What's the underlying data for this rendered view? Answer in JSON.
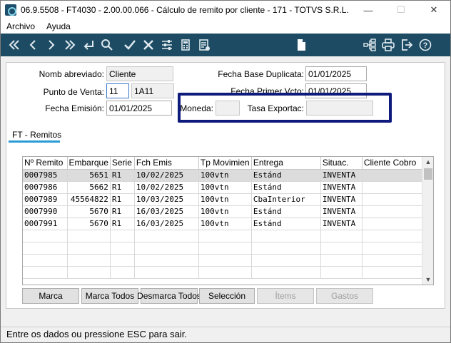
{
  "window": {
    "title": "06.9.5508 - FT4030 - 2.00.00.066 - Cálculo de remito por cliente - 171 - TOTVS S.R.L.",
    "minimize": "—",
    "maximize": "☐",
    "close": "✕"
  },
  "menu": {
    "items": [
      "Archivo",
      "Ayuda"
    ]
  },
  "toolbar": {
    "icons": [
      "first-icon",
      "prev-icon",
      "next-icon",
      "last-icon",
      "return-icon",
      "search-icon",
      "confirm-icon",
      "cancel-icon",
      "settings-sliders-icon",
      "calculator-icon",
      "notes-icon",
      "new-document-icon",
      "tree-icon",
      "print-icon",
      "exit-icon",
      "help-icon"
    ]
  },
  "form": {
    "nomb_abreviado_label": "Nomb abreviado:",
    "nomb_abreviado_value": "Cliente",
    "punto_venta_label": "Punto de Venta:",
    "punto_venta_value": "11",
    "punto_venta_desc": "1A11",
    "fecha_emision_label": "Fecha Emisión:",
    "fecha_emision_value": "01/01/2025",
    "fecha_base_label": "Fecha Base Duplicata:",
    "fecha_base_value": "01/01/2025",
    "fecha_primer_label": "Fecha Primer Vcto:",
    "fecha_primer_value": "01/01/2025",
    "moneda_label": "Moneda:",
    "moneda_value": "",
    "tasa_label": "Tasa Exportac:",
    "tasa_value": "",
    "highlight_color": "#0e1a7c"
  },
  "tab": {
    "label": "FT - Remitos"
  },
  "grid": {
    "columns": [
      "Nº Remito",
      "Embarque",
      "Serie",
      "Fch Emis",
      "Tp Movimien",
      "Entrega",
      "Situac.",
      "Cliente Cobro"
    ],
    "rows": [
      [
        "0007985",
        "5651",
        "R1",
        "10/02/2025",
        "100vtn",
        "Estánd",
        "INVENTA",
        ""
      ],
      [
        "0007986",
        "5662",
        "R1",
        "10/02/2025",
        "100vtn",
        "Estánd",
        "INVENTA",
        ""
      ],
      [
        "0007989",
        "45564822",
        "R1",
        "10/03/2025",
        "100vtn",
        "CbaInterior",
        "INVENTA",
        ""
      ],
      [
        "0007990",
        "5670",
        "R1",
        "16/03/2025",
        "100vtn",
        "Estánd",
        "INVENTA",
        ""
      ],
      [
        "0007991",
        "5670",
        "R1",
        "16/03/2025",
        "100vtn",
        "Estánd",
        "INVENTA",
        ""
      ]
    ],
    "selected_row": 0
  },
  "buttons": {
    "marca": "Marca",
    "marca_todos": "Marca Todos",
    "desmarca_todos": "Desmarca Todos",
    "seleccion": "Selección",
    "items": "Ítems",
    "gastos": "Gastos"
  },
  "status": {
    "text": "Entre os dados ou pressione ESC para sair."
  }
}
